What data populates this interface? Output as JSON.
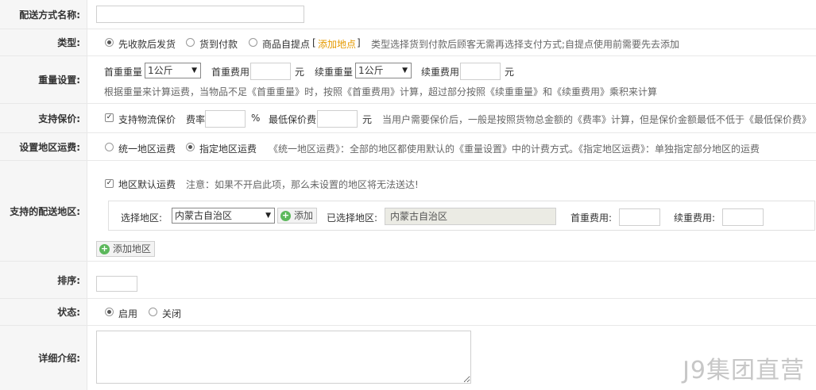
{
  "name_row": {
    "label": "配送方式名称:",
    "value": ""
  },
  "type_row": {
    "label": "类型:",
    "options": [
      "先收款后发货",
      "货到付款",
      "商品自提点"
    ],
    "selected_index": 0,
    "add_link_open": "[",
    "add_link": "添加地点",
    "add_link_close": "]",
    "hint": "类型选择货到付款后顾客无需再选择支付方式;自提点使用前需要先去添加"
  },
  "weight_row": {
    "label": "重量设置:",
    "first_weight_label": "首重重量",
    "first_weight_value": "1公斤",
    "first_fee_label": "首重费用",
    "first_fee_value": "",
    "unit_yuan": "元",
    "cont_weight_label": "续重重量",
    "cont_weight_value": "1公斤",
    "cont_fee_label": "续重费用",
    "cont_fee_value": "",
    "hint": "根据重量来计算运费，当物品不足《首重重量》时，按照《首重费用》计算，超过部分按照《续重重量》和《续重费用》乘积来计算"
  },
  "insure_row": {
    "label": "支持保价:",
    "checkbox_label": "支持物流保价",
    "checked": true,
    "rate_label": "费率",
    "rate_value": "",
    "percent": "%",
    "min_label": "最低保价费",
    "min_value": "",
    "unit_yuan": "元",
    "hint": "当用户需要保价后，一般是按照货物总金额的《费率》计算，但是保价金额最低不低于《最低保价费》"
  },
  "area_fee_row": {
    "label": "设置地区运费:",
    "options": [
      "统一地区运费",
      "指定地区运费"
    ],
    "selected_index": 1,
    "hint": "《统一地区运费》：全部的地区都使用默认的《重量设置》中的计费方式。《指定地区运费》：单独指定部分地区的运费"
  },
  "area_row": {
    "label": "支持的配送地区:",
    "default_checkbox_label": "地区默认运费",
    "default_checked": true,
    "default_hint": "注意：如果不开启此项，那么未设置的地区将无法送达!",
    "select_area_label": "选择地区:",
    "select_area_value": "内蒙古自治区",
    "add_button": "添加",
    "selected_area_label": "已选择地区:",
    "selected_area_value": "内蒙古自治区",
    "first_fee_label": "首重费用:",
    "first_fee_value": "",
    "cont_fee_label": "续重费用:",
    "cont_fee_value": "",
    "add_area_button": "添加地区"
  },
  "sort_row": {
    "label": "排序:",
    "value": ""
  },
  "status_row": {
    "label": "状态:",
    "options": [
      "启用",
      "关闭"
    ],
    "selected_index": 0
  },
  "detail_row": {
    "label": "详细介绍:",
    "value": ""
  },
  "watermark": "J9集团直营",
  "colors": {
    "label_bg": "#f6f6f6",
    "border": "#e8e8e8",
    "link": "#e59a00",
    "add_green": "#5cb85c"
  }
}
